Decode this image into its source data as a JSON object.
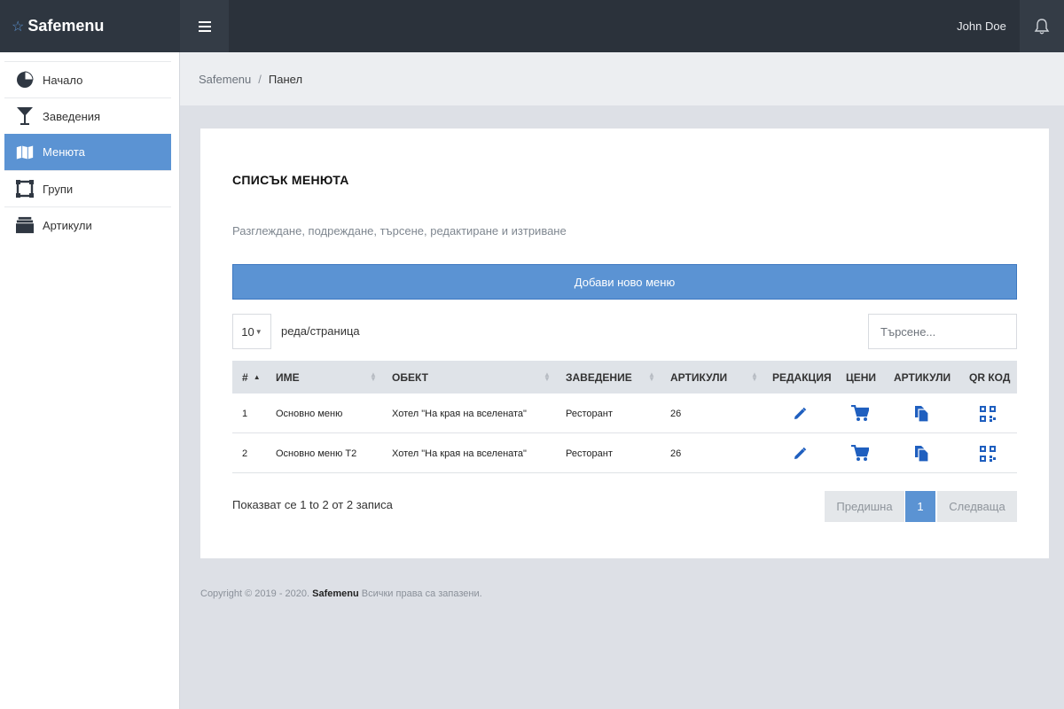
{
  "brand": {
    "name": "Safemenu"
  },
  "header": {
    "user": "John Doe"
  },
  "sidebar": {
    "items": [
      {
        "label": "Начало",
        "icon": "pie-chart-icon"
      },
      {
        "label": "Заведения",
        "icon": "cocktail-icon"
      },
      {
        "label": "Менюта",
        "icon": "map-icon",
        "active": true
      },
      {
        "label": "Групи",
        "icon": "group-icon"
      },
      {
        "label": "Артикули",
        "icon": "box-icon"
      }
    ]
  },
  "breadcrumb": {
    "root": "Safemenu",
    "separator": "/",
    "current": "Панел"
  },
  "card": {
    "title": "СПИСЪК МЕНЮТА",
    "subtitle": "Разглеждане, подреждане, търсене, редактиране и изтриване",
    "add_button": "Добави ново меню"
  },
  "table_controls": {
    "page_size": "10",
    "page_size_label": "реда/страница",
    "search_placeholder": "Търсене..."
  },
  "table": {
    "columns": [
      "#",
      "ИМЕ",
      "ОБЕКТ",
      "ЗАВЕДЕНИЕ",
      "АРТИКУЛИ",
      "РЕДАКЦИЯ",
      "ЦЕНИ",
      "АРТИКУЛИ",
      "QR КОД"
    ],
    "rows": [
      {
        "num": "1",
        "name": "Основно меню",
        "object": "Хотел \"На края на вселената\"",
        "venue": "Ресторант",
        "articles": "26"
      },
      {
        "num": "2",
        "name": "Основно меню Т2",
        "object": "Хотел \"На края на вселената\"",
        "venue": "Ресторант",
        "articles": "26"
      }
    ]
  },
  "pagination": {
    "info": "Показват се 1 to 2 от 2 записа",
    "prev": "Предишна",
    "current": "1",
    "next": "Следваща"
  },
  "footer": {
    "prefix": "Copyright © 2019 - 2020.",
    "brand": "Safemenu",
    "suffix": "Всички права са запазени."
  },
  "colors": {
    "accent": "#5b93d3",
    "topbar": "#2b323b",
    "icon_blue": "#1f5fbf"
  }
}
